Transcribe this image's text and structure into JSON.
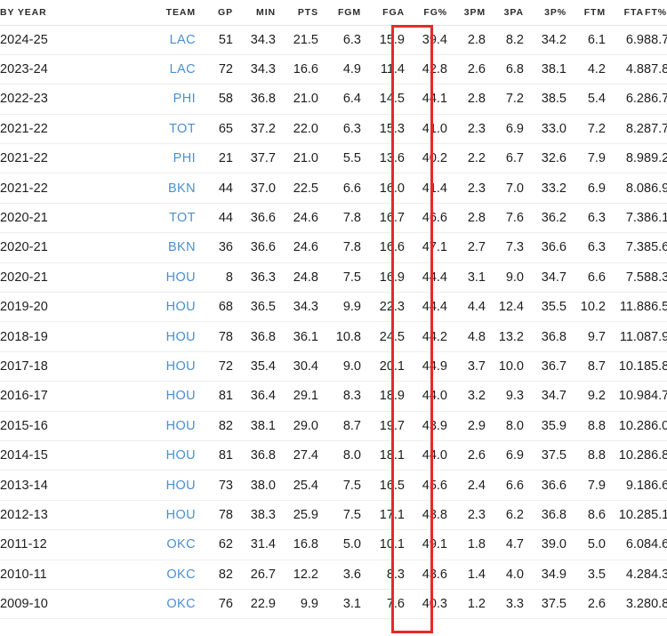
{
  "table": {
    "columns": [
      {
        "key": "year",
        "label": "BY YEAR",
        "align": "left"
      },
      {
        "key": "team",
        "label": "TEAM",
        "align": "right"
      },
      {
        "key": "gp",
        "label": "GP",
        "align": "right"
      },
      {
        "key": "min",
        "label": "MIN",
        "align": "right"
      },
      {
        "key": "pts",
        "label": "PTS",
        "align": "right"
      },
      {
        "key": "fgm",
        "label": "FGM",
        "align": "right"
      },
      {
        "key": "fga",
        "label": "FGA",
        "align": "right"
      },
      {
        "key": "fgp",
        "label": "FG%",
        "align": "right"
      },
      {
        "key": "tpm",
        "label": "3PM",
        "align": "right"
      },
      {
        "key": "tpa",
        "label": "3PA",
        "align": "right"
      },
      {
        "key": "tpp",
        "label": "3P%",
        "align": "right"
      },
      {
        "key": "ftm",
        "label": "FTM",
        "align": "right"
      },
      {
        "key": "fta",
        "label": "FTA",
        "align": "right"
      },
      {
        "key": "ftp",
        "label": "FT%",
        "align": "right"
      }
    ],
    "rows": [
      {
        "year": "2024-25",
        "team": "LAC",
        "gp": "51",
        "min": "34.3",
        "pts": "21.5",
        "fgm": "6.3",
        "fga": "15.9",
        "fgp": "39.4",
        "tpm": "2.8",
        "tpa": "8.2",
        "tpp": "34.2",
        "ftm": "6.1",
        "fta": "6.9",
        "ftp": "88.7"
      },
      {
        "year": "2023-24",
        "team": "LAC",
        "gp": "72",
        "min": "34.3",
        "pts": "16.6",
        "fgm": "4.9",
        "fga": "11.4",
        "fgp": "42.8",
        "tpm": "2.6",
        "tpa": "6.8",
        "tpp": "38.1",
        "ftm": "4.2",
        "fta": "4.8",
        "ftp": "87.8"
      },
      {
        "year": "2022-23",
        "team": "PHI",
        "gp": "58",
        "min": "36.8",
        "pts": "21.0",
        "fgm": "6.4",
        "fga": "14.5",
        "fgp": "44.1",
        "tpm": "2.8",
        "tpa": "7.2",
        "tpp": "38.5",
        "ftm": "5.4",
        "fta": "6.2",
        "ftp": "86.7"
      },
      {
        "year": "2021-22",
        "team": "TOT",
        "gp": "65",
        "min": "37.2",
        "pts": "22.0",
        "fgm": "6.3",
        "fga": "15.3",
        "fgp": "41.0",
        "tpm": "2.3",
        "tpa": "6.9",
        "tpp": "33.0",
        "ftm": "7.2",
        "fta": "8.2",
        "ftp": "87.7"
      },
      {
        "year": "2021-22",
        "team": "PHI",
        "gp": "21",
        "min": "37.7",
        "pts": "21.0",
        "fgm": "5.5",
        "fga": "13.6",
        "fgp": "40.2",
        "tpm": "2.2",
        "tpa": "6.7",
        "tpp": "32.6",
        "ftm": "7.9",
        "fta": "8.9",
        "ftp": "89.2"
      },
      {
        "year": "2021-22",
        "team": "BKN",
        "gp": "44",
        "min": "37.0",
        "pts": "22.5",
        "fgm": "6.6",
        "fga": "16.0",
        "fgp": "41.4",
        "tpm": "2.3",
        "tpa": "7.0",
        "tpp": "33.2",
        "ftm": "6.9",
        "fta": "8.0",
        "ftp": "86.9"
      },
      {
        "year": "2020-21",
        "team": "TOT",
        "gp": "44",
        "min": "36.6",
        "pts": "24.6",
        "fgm": "7.8",
        "fga": "16.7",
        "fgp": "46.6",
        "tpm": "2.8",
        "tpa": "7.6",
        "tpp": "36.2",
        "ftm": "6.3",
        "fta": "7.3",
        "ftp": "86.1"
      },
      {
        "year": "2020-21",
        "team": "BKN",
        "gp": "36",
        "min": "36.6",
        "pts": "24.6",
        "fgm": "7.8",
        "fga": "16.6",
        "fgp": "47.1",
        "tpm": "2.7",
        "tpa": "7.3",
        "tpp": "36.6",
        "ftm": "6.3",
        "fta": "7.3",
        "ftp": "85.6"
      },
      {
        "year": "2020-21",
        "team": "HOU",
        "gp": "8",
        "min": "36.3",
        "pts": "24.8",
        "fgm": "7.5",
        "fga": "16.9",
        "fgp": "44.4",
        "tpm": "3.1",
        "tpa": "9.0",
        "tpp": "34.7",
        "ftm": "6.6",
        "fta": "7.5",
        "ftp": "88.3"
      },
      {
        "year": "2019-20",
        "team": "HOU",
        "gp": "68",
        "min": "36.5",
        "pts": "34.3",
        "fgm": "9.9",
        "fga": "22.3",
        "fgp": "44.4",
        "tpm": "4.4",
        "tpa": "12.4",
        "tpp": "35.5",
        "ftm": "10.2",
        "fta": "11.8",
        "ftp": "86.5"
      },
      {
        "year": "2018-19",
        "team": "HOU",
        "gp": "78",
        "min": "36.8",
        "pts": "36.1",
        "fgm": "10.8",
        "fga": "24.5",
        "fgp": "44.2",
        "tpm": "4.8",
        "tpa": "13.2",
        "tpp": "36.8",
        "ftm": "9.7",
        "fta": "11.0",
        "ftp": "87.9"
      },
      {
        "year": "2017-18",
        "team": "HOU",
        "gp": "72",
        "min": "35.4",
        "pts": "30.4",
        "fgm": "9.0",
        "fga": "20.1",
        "fgp": "44.9",
        "tpm": "3.7",
        "tpa": "10.0",
        "tpp": "36.7",
        "ftm": "8.7",
        "fta": "10.1",
        "ftp": "85.8"
      },
      {
        "year": "2016-17",
        "team": "HOU",
        "gp": "81",
        "min": "36.4",
        "pts": "29.1",
        "fgm": "8.3",
        "fga": "18.9",
        "fgp": "44.0",
        "tpm": "3.2",
        "tpa": "9.3",
        "tpp": "34.7",
        "ftm": "9.2",
        "fta": "10.9",
        "ftp": "84.7"
      },
      {
        "year": "2015-16",
        "team": "HOU",
        "gp": "82",
        "min": "38.1",
        "pts": "29.0",
        "fgm": "8.7",
        "fga": "19.7",
        "fgp": "43.9",
        "tpm": "2.9",
        "tpa": "8.0",
        "tpp": "35.9",
        "ftm": "8.8",
        "fta": "10.2",
        "ftp": "86.0"
      },
      {
        "year": "2014-15",
        "team": "HOU",
        "gp": "81",
        "min": "36.8",
        "pts": "27.4",
        "fgm": "8.0",
        "fga": "18.1",
        "fgp": "44.0",
        "tpm": "2.6",
        "tpa": "6.9",
        "tpp": "37.5",
        "ftm": "8.8",
        "fta": "10.2",
        "ftp": "86.8"
      },
      {
        "year": "2013-14",
        "team": "HOU",
        "gp": "73",
        "min": "38.0",
        "pts": "25.4",
        "fgm": "7.5",
        "fga": "16.5",
        "fgp": "45.6",
        "tpm": "2.4",
        "tpa": "6.6",
        "tpp": "36.6",
        "ftm": "7.9",
        "fta": "9.1",
        "ftp": "86.6"
      },
      {
        "year": "2012-13",
        "team": "HOU",
        "gp": "78",
        "min": "38.3",
        "pts": "25.9",
        "fgm": "7.5",
        "fga": "17.1",
        "fgp": "43.8",
        "tpm": "2.3",
        "tpa": "6.2",
        "tpp": "36.8",
        "ftm": "8.6",
        "fta": "10.2",
        "ftp": "85.1"
      },
      {
        "year": "2011-12",
        "team": "OKC",
        "gp": "62",
        "min": "31.4",
        "pts": "16.8",
        "fgm": "5.0",
        "fga": "10.1",
        "fgp": "49.1",
        "tpm": "1.8",
        "tpa": "4.7",
        "tpp": "39.0",
        "ftm": "5.0",
        "fta": "6.0",
        "ftp": "84.6"
      },
      {
        "year": "2010-11",
        "team": "OKC",
        "gp": "82",
        "min": "26.7",
        "pts": "12.2",
        "fgm": "3.6",
        "fga": "8.3",
        "fgp": "43.6",
        "tpm": "1.4",
        "tpa": "4.0",
        "tpp": "34.9",
        "ftm": "3.5",
        "fta": "4.2",
        "ftp": "84.3"
      },
      {
        "year": "2009-10",
        "team": "OKC",
        "gp": "76",
        "min": "22.9",
        "pts": "9.9",
        "fgm": "3.1",
        "fga": "7.6",
        "fgp": "40.3",
        "tpm": "1.2",
        "tpa": "3.3",
        "tpp": "37.5",
        "ftm": "2.6",
        "fta": "3.2",
        "ftp": "80.8"
      }
    ]
  },
  "annotation": {
    "highlight_column": "FG%",
    "highlight_color": "#e8282b"
  },
  "colors": {
    "team_link": "#4a8fd1",
    "text": "#1d1d1d",
    "row_border": "#ededed",
    "header_border": "#e4e4e4",
    "background": "#ffffff"
  }
}
